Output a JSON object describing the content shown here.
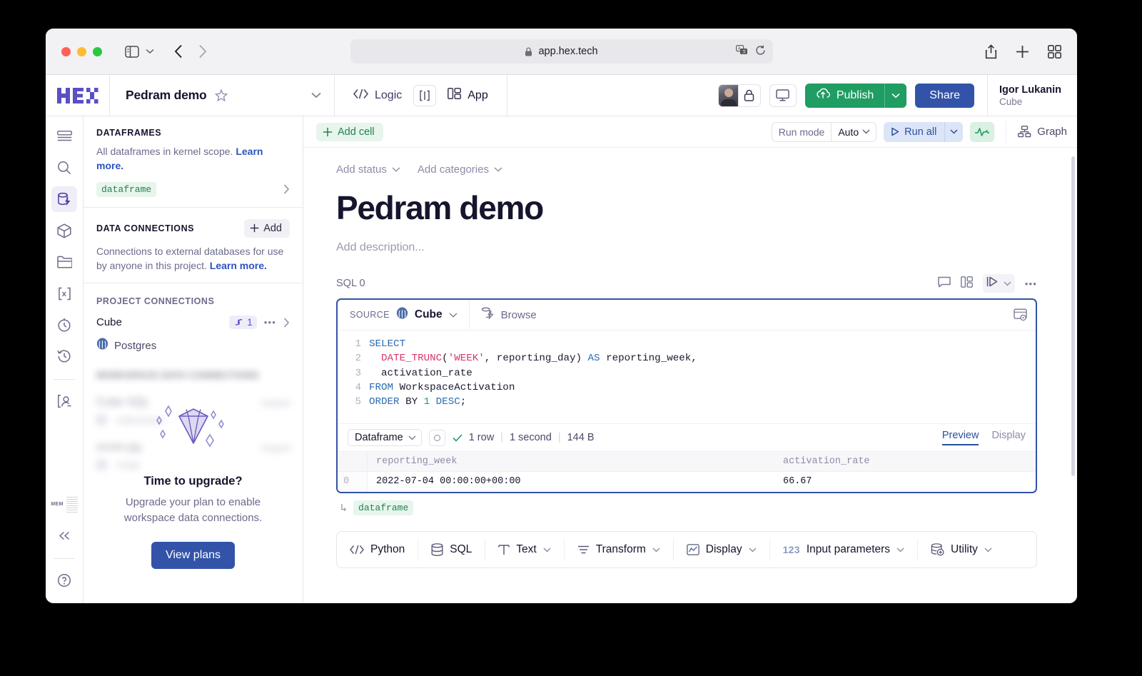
{
  "browser": {
    "url": "app.hex.tech",
    "lock_icon": "lock-icon",
    "translate_icon": "translate-icon",
    "reload_icon": "reload-icon",
    "sidebar_icon": "sidebar-toggle-icon",
    "back_icon": "back-arrow-icon",
    "forward_icon": "forward-arrow-icon",
    "share_icon": "share-icon",
    "new_tab_icon": "plus-icon",
    "tabs_overview_icon": "tab-grid-icon"
  },
  "topbar": {
    "logo": "HEX",
    "project_title": "Pedram demo",
    "star_icon": "star-icon",
    "title_chevron": "chevron-down-icon",
    "tabs": [
      {
        "label": "Logic",
        "icon": "code-brackets-icon"
      },
      {
        "label": "App",
        "icon": "app-layout-icon"
      }
    ],
    "split_icon": "split-view-icon",
    "lock_icon": "lock-icon",
    "present_icon": "monitor-icon",
    "publish_label": "Publish",
    "publish_icon": "cloud-upload-icon",
    "publish_caret": "chevron-down-icon",
    "publish_color": "#1f9d62",
    "share_label": "Share",
    "share_color": "#3253a8",
    "user_name": "Igor Lukanin",
    "user_org": "Cube"
  },
  "rail": {
    "items": [
      {
        "name": "outline-icon"
      },
      {
        "name": "search-icon"
      },
      {
        "name": "data-sources-icon"
      },
      {
        "name": "package-icon"
      },
      {
        "name": "files-icon"
      },
      {
        "name": "variables-icon"
      },
      {
        "name": "schedules-icon"
      },
      {
        "name": "history-icon"
      },
      {
        "name": "review-icon"
      }
    ],
    "mem_label": "MEM",
    "collapse_icon": "double-chevron-left-icon",
    "help_icon": "help-circle-icon"
  },
  "left_panel": {
    "dataframes": {
      "title": "DATAFRAMES",
      "description": "All dataframes in kernel scope.",
      "learn_more": "Learn more.",
      "items": [
        {
          "label": "dataframe"
        }
      ]
    },
    "data_connections": {
      "title": "DATA CONNECTIONS",
      "add_label": "Add",
      "add_icon": "plus-icon",
      "description": "Connections to external databases for use by anyone in this project.",
      "learn_more": "Learn more."
    },
    "project_connections": {
      "title": "PROJECT CONNECTIONS",
      "items": [
        {
          "name": "Cube",
          "badge": "1",
          "badge_icon": "link-icon",
          "more_icon": "ellipsis-icon",
          "chevron": "chevron-right-icon"
        },
        {
          "name": "Postgres",
          "icon": "postgres-icon"
        }
      ]
    },
    "workspace_blurred": {
      "title": "WORKSPACE DATA CONNECTIONS",
      "items": [
        {
          "name": "Cube SQL",
          "action": "Import",
          "meta": "cubecloud..."
        },
        {
          "name": "ecom-pg",
          "action": "Import",
          "meta": "Cube"
        }
      ]
    },
    "upgrade": {
      "icon": "diamond-icon",
      "title": "Time to upgrade?",
      "subtitle": "Upgrade your plan to enable workspace data connections.",
      "button": "View plans"
    }
  },
  "main_toolbar": {
    "add_cell": "Add cell",
    "add_cell_icon": "plus-icon",
    "run_mode_label": "Run mode",
    "run_mode_value": "Auto",
    "run_mode_caret": "chevron-down-icon",
    "run_all": "Run all",
    "run_all_icon": "play-icon",
    "run_all_caret": "chevron-down-icon",
    "activity_icon": "activity-pulse-icon",
    "graph_label": "Graph",
    "graph_icon": "graph-nodes-icon"
  },
  "document": {
    "status_label": "Add status",
    "status_caret": "chevron-down-icon",
    "categories_label": "Add categories",
    "categories_caret": "chevron-down-icon",
    "title": "Pedram demo",
    "description_placeholder": "Add description..."
  },
  "cell": {
    "label": "SQL 0",
    "tools": [
      {
        "name": "comment-icon"
      },
      {
        "name": "layout-icon"
      },
      {
        "name": "run-cell-icon"
      },
      {
        "name": "chevron-down-icon"
      },
      {
        "name": "ellipsis-icon"
      }
    ],
    "source_label": "SOURCE",
    "source_name": "Cube",
    "source_icon": "postgres-icon",
    "source_caret": "chevron-down-icon",
    "browse_label": "Browse",
    "browse_icon": "browse-data-icon",
    "head_right_icon": "sql-settings-icon",
    "code_lines": [
      {
        "no": "1",
        "html": "<span class='k'>SELECT</span>"
      },
      {
        "no": "2",
        "html": "  <span class='fn'>DATE_TRUNC</span>(<span class='str'>'WEEK'</span>, reporting_day) <span class='k'>AS</span> reporting_week,"
      },
      {
        "no": "3",
        "html": "  activation_rate"
      },
      {
        "no": "4",
        "html": "<span class='k'>FROM</span> WorkspaceActivation"
      },
      {
        "no": "5",
        "html": "<span class='k'>ORDER</span> BY <span class='num'>1</span> <span class='k'>DESC</span>;"
      }
    ],
    "result": {
      "dataframe_label": "Dataframe",
      "dataframe_caret": "chevron-down-icon",
      "refresh_icon": "circle-icon",
      "check_icon": "check-icon",
      "rows": "1 row",
      "duration": "1 second",
      "size": "144 B",
      "tabs": [
        {
          "label": "Preview",
          "active": true
        },
        {
          "label": "Display",
          "active": false
        }
      ],
      "columns": [
        "reporting_week",
        "activation_rate"
      ],
      "rows_data": [
        {
          "index": "0",
          "reporting_week": "2022-07-04 00:00:00+00:00",
          "activation_rate": "66.67"
        }
      ]
    },
    "output_chip": "dataframe",
    "output_arrow": "↳"
  },
  "palette": {
    "items": [
      {
        "label": "Python",
        "icon": "code-brackets-icon",
        "caret": ""
      },
      {
        "label": "SQL",
        "icon": "database-icon",
        "caret": ""
      },
      {
        "label": "Text",
        "icon": "text-icon",
        "caret": "chevron-down-icon"
      },
      {
        "label": "Transform",
        "icon": "transform-icon",
        "caret": "chevron-down-icon"
      },
      {
        "label": "Display",
        "icon": "chart-icon",
        "caret": "chevron-down-icon"
      },
      {
        "label": "Input parameters",
        "icon": "123-icon",
        "caret": "chevron-down-icon"
      },
      {
        "label": "Utility",
        "icon": "database-plus-icon",
        "caret": "chevron-down-icon"
      }
    ]
  }
}
